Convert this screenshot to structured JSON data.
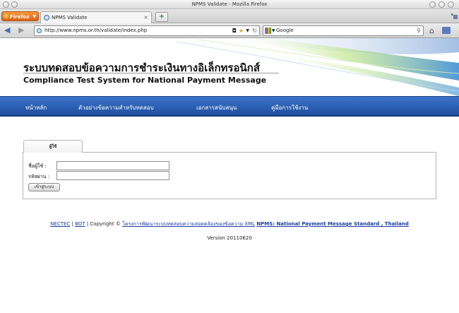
{
  "window": {
    "title": "NPMS Validate - Mozilla Firefox"
  },
  "browser": {
    "app_menu_label": "Firefox",
    "tab_title": "NPMS Validate",
    "url": "http://www.npms.or.th/validate/index.php",
    "search_engine": "Google",
    "search_placeholder": "Google"
  },
  "page": {
    "title_th": "ระบบทดสอบข้อความการชำระเงินทางอิเล็กทรอนิกส์",
    "title_en": "Compliance Test System for National Payment Message",
    "menu": [
      {
        "label": "หน้าหลัก"
      },
      {
        "label": "ตัวอย่างข้อความสำหรับทดสอบ"
      },
      {
        "label": "เอกสารสนับสนุน"
      },
      {
        "label": "คู่มือการใช้งาน"
      }
    ],
    "login": {
      "tab_label": "ผู้ใช้",
      "username_label": "ชื่อผู้ใช้ :",
      "password_label": "รหัสผ่าน :",
      "username_value": "",
      "password_value": "",
      "submit_label": "เข้าสู่ระบบ"
    },
    "footer": {
      "nectec": "NECTEC",
      "sep1": " | ",
      "bot": "BOT",
      "copyright": " | Copyright © ",
      "project": "โครงการพัฒนาระบบทดสอบความสอดคล้องของข้อความ XML",
      "npms": "NPMS: National Payment Message Standard , Thailand",
      "version": "Version 20110620"
    }
  },
  "colors": {
    "menu_bar": "#2a5fb5",
    "firefox_button": "#e8782a",
    "link": "#1a3da0"
  }
}
